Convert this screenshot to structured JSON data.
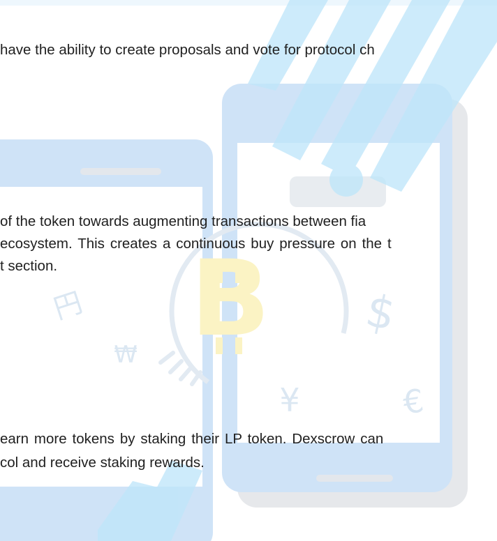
{
  "document": {
    "lines": [
      "have the ability to create proposals and vote for protocol ch",
      "of the token towards augmenting transactions between fia",
      "ecosystem. This creates a continuous buy pressure on the t",
      "t section.",
      "earn more tokens by staking their LP token. Dexscrow can",
      "col and receive staking rewards."
    ]
  },
  "background": {
    "phone_color": "#cfe3f7",
    "phone_screen_color": "#ffffff",
    "bitcoin_color": "#fbf3c4",
    "symbol_color": "#dbe7f2",
    "streak_color": "#a9ddf6",
    "icons": [
      "smartphone-icon",
      "bitcoin-icon",
      "dollar-icon",
      "yen-icon",
      "euro-icon",
      "won-icon"
    ]
  }
}
